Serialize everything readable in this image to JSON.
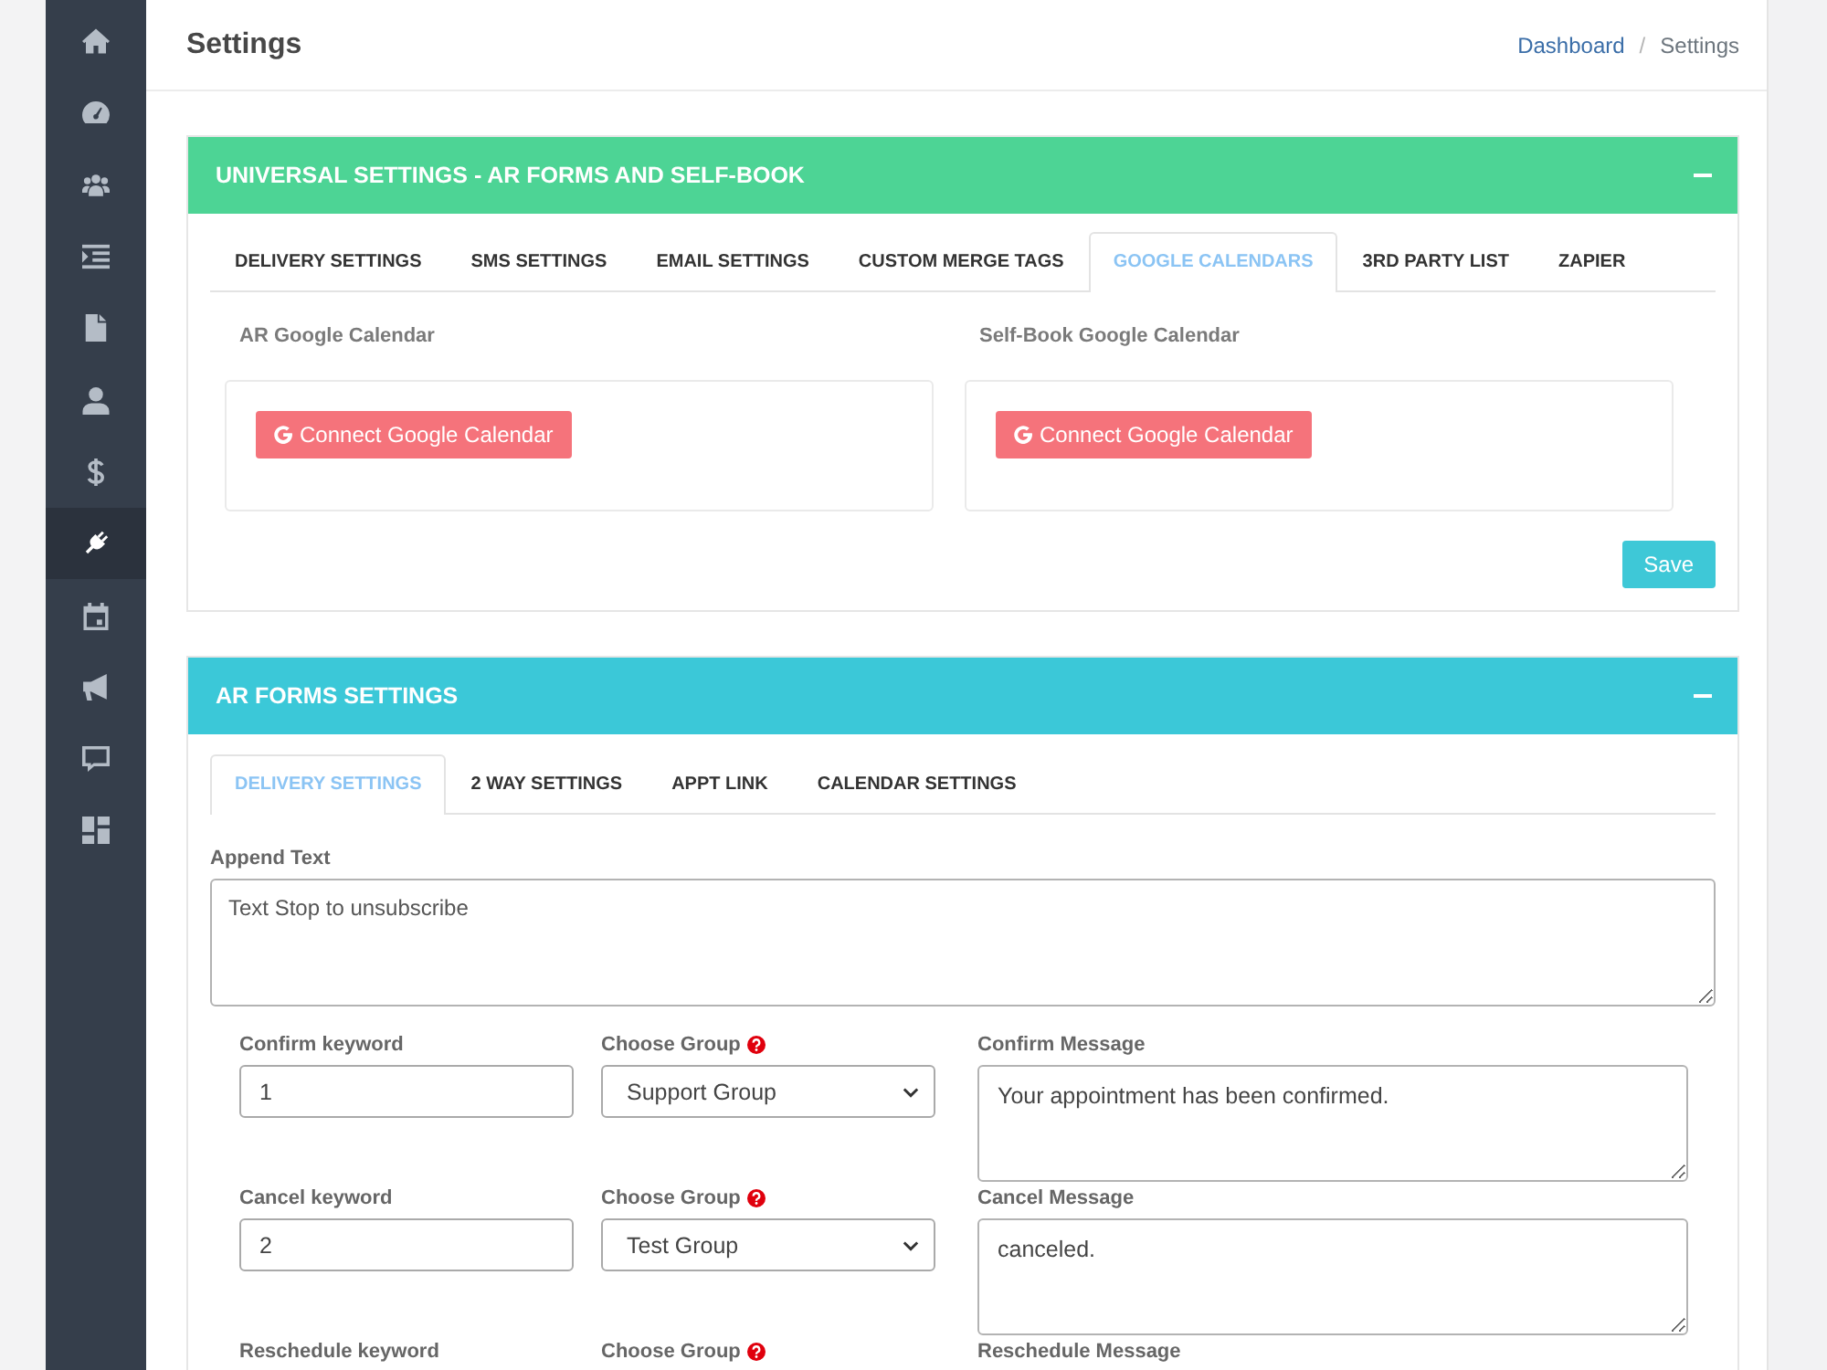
{
  "sidebar": {
    "items": [
      {
        "selected": false
      },
      {
        "selected": false
      },
      {
        "selected": false
      },
      {
        "selected": false
      },
      {
        "selected": false
      },
      {
        "selected": false
      },
      {
        "selected": false
      },
      {
        "selected": true
      },
      {
        "selected": false
      },
      {
        "selected": false
      },
      {
        "selected": false
      },
      {
        "selected": false
      }
    ]
  },
  "header": {
    "title": "Settings",
    "breadcrumb": {
      "items": [
        {
          "label": "Dashboard",
          "kind": "link"
        },
        {
          "label": "Settings",
          "kind": "current"
        }
      ],
      "separator": "/"
    }
  },
  "universal_settings": {
    "title": "UNIVERSAL SETTINGS - AR FORMS AND SELF-BOOK",
    "tabs": [
      {
        "label": "DELIVERY SETTINGS",
        "selected": false
      },
      {
        "label": "SMS SETTINGS",
        "selected": false
      },
      {
        "label": "EMAIL SETTINGS",
        "selected": false
      },
      {
        "label": "CUSTOM MERGE TAGS",
        "selected": false
      },
      {
        "label": "GOOGLE CALENDARS",
        "selected": true
      },
      {
        "label": "3RD PARTY LIST",
        "selected": false
      },
      {
        "label": "ZAPIER",
        "selected": false
      }
    ],
    "calendars": [
      {
        "label": "AR Google Calendar",
        "button": "Connect Google Calendar"
      },
      {
        "label": "Self-Book Google Calendar",
        "button": "Connect Google Calendar"
      }
    ],
    "save_button": "Save"
  },
  "ar_forms_settings": {
    "title": "AR FORMS SETTINGS",
    "tabs": [
      {
        "label": "DELIVERY SETTINGS",
        "selected": true
      },
      {
        "label": "2 WAY SETTINGS",
        "selected": false
      },
      {
        "label": "APPT LINK",
        "selected": false
      },
      {
        "label": "CALENDAR SETTINGS",
        "selected": false
      }
    ],
    "append_text": {
      "label": "Append Text",
      "value": "Text Stop to unsubscribe"
    },
    "rows": [
      {
        "keyword_label": "Confirm keyword",
        "keyword": "1",
        "group_label": "Choose Group",
        "group": "Support Group",
        "message_label": "Confirm Message",
        "message": "Your appointment has been confirmed."
      },
      {
        "keyword_label": "Cancel keyword",
        "keyword": "2",
        "group_label": "Choose Group",
        "group": "Test Group",
        "message_label": "Cancel Message",
        "message": "canceled."
      },
      {
        "keyword_label": "Reschedule keyword",
        "group_label": "Choose Group",
        "message_label": "Reschedule Message"
      }
    ]
  }
}
